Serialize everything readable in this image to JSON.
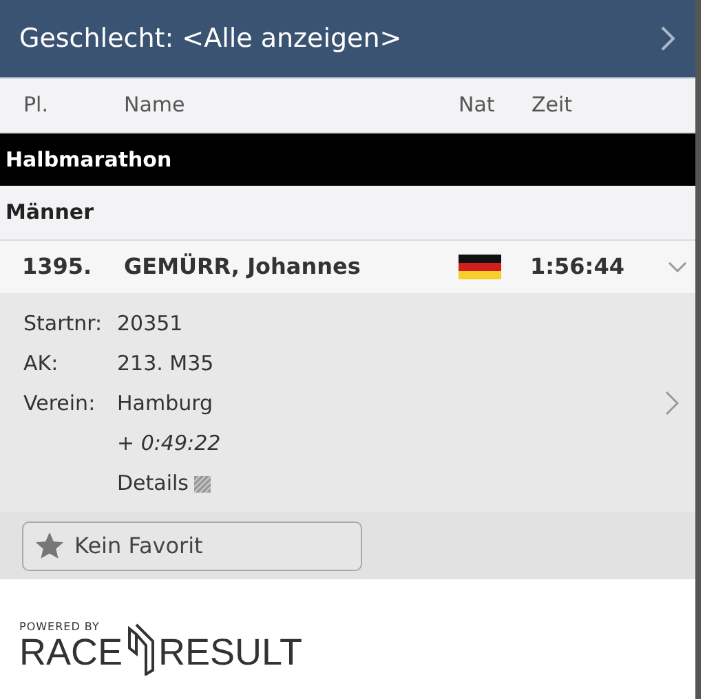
{
  "header": {
    "title": "Geschlecht: <Alle anzeigen>"
  },
  "columns": [
    "Pl.",
    "Name",
    "Nat",
    "Zeit"
  ],
  "race": "Halbmarathon",
  "group": "Männer",
  "result": {
    "place": "1395.",
    "name": "GEMÜRR, Johannes",
    "time": "1:56:44",
    "expanded": true,
    "details": [
      {
        "label": "Startnr:",
        "value": "20351"
      },
      {
        "label": "AK:",
        "value": "213. M35"
      },
      {
        "label": "Verein:",
        "value": "Hamburg"
      }
    ],
    "gap": "+ 0:49:22",
    "details_link": "Details"
  },
  "favorite_button": "Kein Favorit",
  "footer": {
    "powered_by": "POWERED BY",
    "brand_left": "RACE",
    "brand_right": "RESULT"
  }
}
